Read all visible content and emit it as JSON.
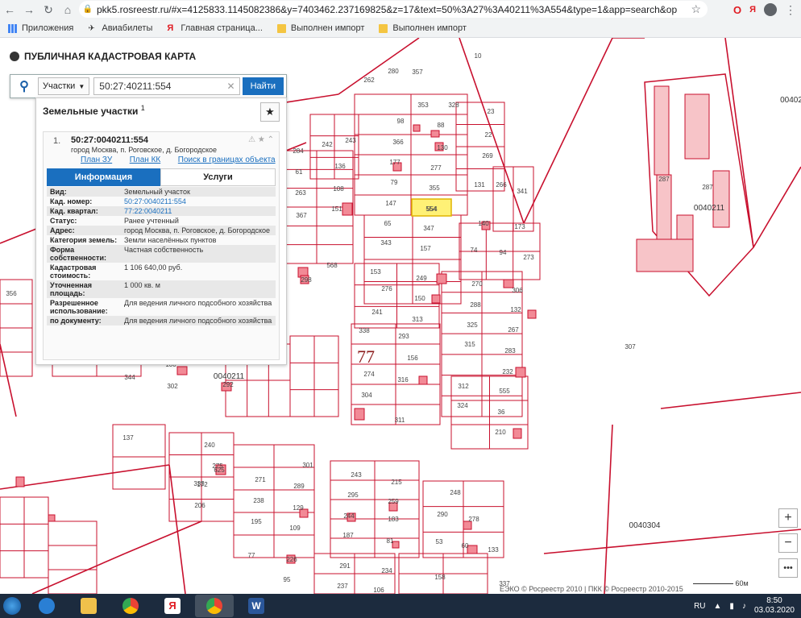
{
  "browser": {
    "url": "pkk5.rosreestr.ru/#x=4125833.1145082386&y=7403462.237169825&z=17&text=50%3A27%3A40211%3A554&type=1&app=search&opened=1",
    "extension_label": "Я"
  },
  "bookmarks": [
    {
      "label": "Приложения",
      "icon": "apps-icon"
    },
    {
      "label": "Авиабилеты",
      "icon": "plane-icon"
    },
    {
      "label": "Главная страница...",
      "icon": "yandex-icon"
    },
    {
      "label": "Выполнен импорт",
      "icon": "folder-icon"
    },
    {
      "label": "Выполнен импорт",
      "icon": "folder-icon"
    }
  ],
  "header": {
    "title": "ПУБЛИЧНАЯ КАДАСТРОВАЯ КАРТА"
  },
  "search": {
    "type_label": "Участки",
    "query": "50:27:40211:554",
    "find_label": "Найти"
  },
  "results": {
    "title": "Земельные участки",
    "count": "1",
    "card": {
      "index": "1.",
      "number": "50:27:0040211:554",
      "address": "город Москва, п. Роговское, д. Богородское",
      "links": [
        "План ЗУ →",
        "План КК →",
        "Поиск в границах объекта →"
      ],
      "tabs": [
        "Информация",
        "Услуги"
      ],
      "props": [
        {
          "k": "Вид:",
          "v": "Земельный участок",
          "link": false
        },
        {
          "k": "Кад. номер:",
          "v": "50:27:0040211:554",
          "link": true
        },
        {
          "k": "Кад. квартал:",
          "v": "77:22:0040211",
          "link": true
        },
        {
          "k": "Статус:",
          "v": "Ранее учтенный",
          "link": false
        },
        {
          "k": "Адрес:",
          "v": "город Москва, п. Роговское, д. Богородское",
          "link": false
        },
        {
          "k": "Категория земель:",
          "v": "Земли населённых пунктов",
          "link": false
        },
        {
          "k": "Форма собственности:",
          "v": "Частная собственность",
          "link": false
        },
        {
          "k": "Кадастровая стоимость:",
          "v": "1 106 640,00 руб.",
          "link": false
        },
        {
          "k": "Уточненная площадь:",
          "v": "1 000 кв. м",
          "link": false
        },
        {
          "k": "Разрешенное использование:",
          "v": "Для ведения личного подсобного хозяйства",
          "link": false
        },
        {
          "k": "по документу:",
          "v": "Для ведения личного подсобного хозяйства",
          "link": false
        }
      ]
    }
  },
  "map": {
    "big_label": "77",
    "quarter_labels": [
      "0040211",
      "0040211",
      "0040304",
      "0040211",
      "00402"
    ],
    "selected_parcel": "554",
    "parcel_labels": [
      "10",
      "280",
      "357",
      "262",
      "353",
      "328",
      "98",
      "88",
      "23",
      "366",
      "130",
      "22",
      "269",
      "177",
      "277",
      "79",
      "355",
      "131",
      "266",
      "341",
      "147",
      "554",
      "65",
      "347",
      "140",
      "173",
      "343",
      "157",
      "74",
      "94",
      "273",
      "108",
      "136",
      "61",
      "263",
      "367",
      "151",
      "153",
      "249",
      "270",
      "306",
      "276",
      "150",
      "288",
      "132",
      "241",
      "313",
      "325",
      "267",
      "338",
      "293",
      "315",
      "283",
      "156",
      "274",
      "316",
      "232",
      "304",
      "312",
      "555",
      "324",
      "36",
      "311",
      "210",
      "307",
      "287",
      "287",
      "284",
      "242",
      "243",
      "298",
      "568",
      "356",
      "344",
      "302",
      "100",
      "292",
      "137",
      "240",
      "275",
      "335",
      "625",
      "172",
      "206",
      "301",
      "289",
      "271",
      "238",
      "195",
      "129",
      "109",
      "243",
      "215",
      "295",
      "259",
      "244",
      "183",
      "187",
      "81",
      "248",
      "290",
      "278",
      "53",
      "60",
      "133",
      "77",
      "226",
      "291",
      "234",
      "158",
      "337",
      "95",
      "237",
      "106"
    ],
    "scale_label": "60м"
  },
  "copyright": "ЕЭКО © Росреестр 2010 | ПКК © Росреестр 2010-2015",
  "taskbar": {
    "lang": "RU",
    "time": "8:50",
    "date": "03.03.2020"
  },
  "colors": {
    "parcel_border": "#c8102e",
    "selected_fill": "#fff176",
    "accent": "#1a6fbf"
  }
}
